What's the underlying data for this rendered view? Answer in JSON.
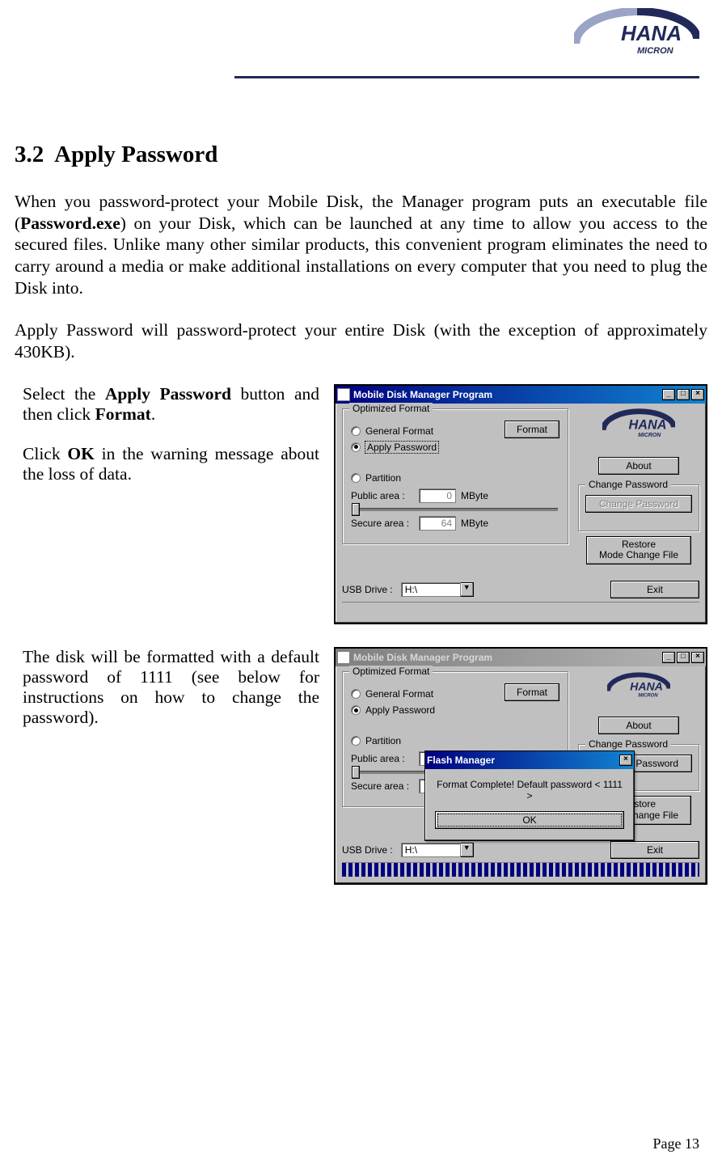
{
  "header": {
    "logo_main": "HANA",
    "logo_sub": "MICRON"
  },
  "section": {
    "number": "3.2",
    "title": "Apply Password"
  },
  "paragraphs": {
    "p1_a": "When you password-protect your Mobile Disk, the Manager program puts an executable file (",
    "p1_b": "Password.exe",
    "p1_c": ") on your Disk, which can be launched at any time to allow you access to the secured files.  Unlike many other similar products, this convenient program eliminates the need to carry around a media or make additional installations on every computer that you need to plug the Disk into.",
    "p2": "Apply Password will password-protect your entire Disk (with the exception of approximately 430KB)."
  },
  "steps": {
    "s1_a": "Select the ",
    "s1_b": "Apply Password",
    "s1_c": " button and then click ",
    "s1_d": "Format",
    "s1_e": ".",
    "s2_a": "Click ",
    "s2_b": "OK",
    "s2_c": " in the warning message about the loss of data.",
    "s3": "The disk will be formatted with a default password of 1111 (see below for instructions on how to change the password)."
  },
  "app": {
    "title": "Mobile Disk Manager Program",
    "group_optimized": "Optimized Format",
    "radio_general": "General Format",
    "radio_apply": "Apply Password",
    "radio_partition": "Partition",
    "btn_format": "Format",
    "label_public": "Public area :",
    "label_secure": "Secure area :",
    "unit": "MByte",
    "public_val": "0",
    "secure_val": "64",
    "label_usb": "USB Drive :",
    "usb_val": "H:\\",
    "btn_about": "About",
    "group_changepw": "Change Password",
    "btn_changepw": "Change Password",
    "btn_restore_l1": "Restore",
    "btn_restore_l2": "Mode Change File",
    "btn_exit": "Exit",
    "logo_main": "HANA",
    "logo_sub": "MICRON"
  },
  "modal": {
    "title": "Flash Manager",
    "message": "Format Complete! Default password < 1111 >",
    "ok": "OK"
  },
  "footer": {
    "page": "Page 13"
  }
}
